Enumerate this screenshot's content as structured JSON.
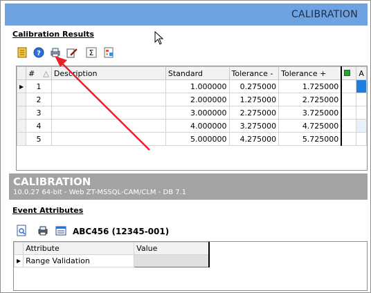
{
  "window": {
    "title": "CALIBRATION"
  },
  "calibration_results": {
    "section_title": "Calibration Results",
    "toolbar_icons": [
      "notebook-icon",
      "help-icon",
      "print-icon",
      "edit-icon",
      "sigma-icon",
      "report-icon"
    ],
    "columns": [
      "#",
      "Description",
      "Standard",
      "Tolerance -",
      "Tolerance +",
      "",
      "A"
    ],
    "rows": [
      {
        "num": "1",
        "description": "",
        "standard": "1.000000",
        "tol_minus": "0.275000",
        "tol_plus": "1.725000"
      },
      {
        "num": "2",
        "description": "",
        "standard": "2.000000",
        "tol_minus": "1.275000",
        "tol_plus": "2.725000"
      },
      {
        "num": "3",
        "description": "",
        "standard": "3.000000",
        "tol_minus": "2.275000",
        "tol_plus": "3.725000"
      },
      {
        "num": "4",
        "description": "",
        "standard": "4.000000",
        "tol_minus": "3.275000",
        "tol_plus": "4.725000"
      },
      {
        "num": "5",
        "description": "",
        "standard": "5.000000",
        "tol_minus": "4.275000",
        "tol_plus": "5.725000"
      }
    ]
  },
  "header": {
    "title": "CALIBRATION",
    "subtitle": "10.0.27 64-bit - Web ZT-MSSQL-CAM/CLM - DB 7.1"
  },
  "event_attributes": {
    "section_title": "Event Attributes",
    "record_name": "ABC456 (12345-001)",
    "columns": [
      "Attribute",
      "Value"
    ],
    "rows": [
      {
        "attribute": "Range Validation",
        "value": ""
      }
    ]
  },
  "colors": {
    "title_bar": "#6fa2e1",
    "header_bar": "#a3a3a3",
    "annotation_arrow": "#e8202a",
    "selected_cell": "#1e7fe0"
  }
}
